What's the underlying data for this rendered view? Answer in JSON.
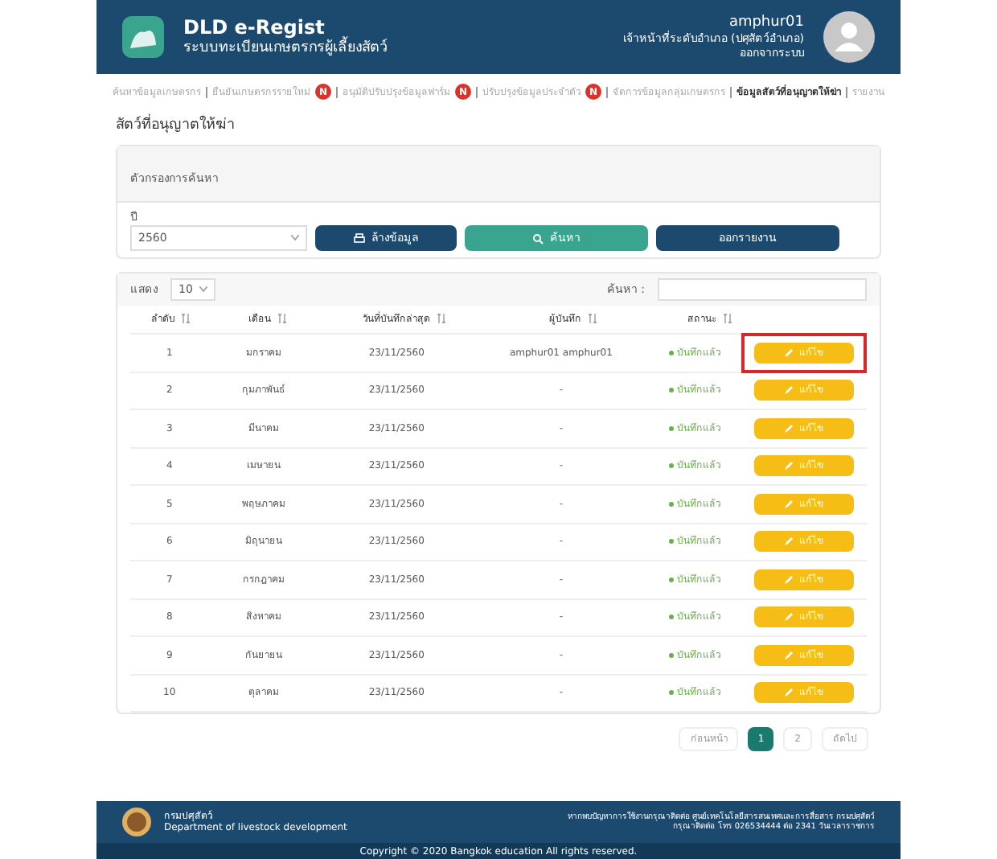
{
  "header": {
    "app_title": "DLD e-Regist",
    "app_subtitle": "ระบบทะเบียนเกษตรกรผู้เลี้ยงสัตว์",
    "username": "amphur01",
    "role": "เจ้าหน้าที่ระดับอำเภอ (ปศุสัตว์อำเภอ)",
    "logout": "ออกจากระบบ"
  },
  "nav": [
    {
      "label": "ค้นหาข้อมูลเกษตรกร",
      "selected": false
    },
    {
      "label": "ยืนยันเกษตรกรรายใหม่",
      "badge": "N",
      "selected": false
    },
    {
      "label": "อนุมัติปรับปรุงข้อมูลฟาร์ม",
      "badge": "N",
      "selected": false
    },
    {
      "label": "ปรับปรุงข้อมูลประจำตัว",
      "badge": "N",
      "selected": false
    },
    {
      "label": "จัดการข้อมูลกลุ่มเกษตรกร",
      "selected": false
    },
    {
      "label": "ข้อมูลสัตว์ที่อนุญาตให้ฆ่า",
      "selected": true
    },
    {
      "label": "รายงาน",
      "selected": false
    }
  ],
  "page_title": "สัตว์ที่อนุญาตให้ฆ่า",
  "filter": {
    "title": "ตัวกรองการค้นหา",
    "year_label": "ปี",
    "year_value": "2560",
    "buttons": [
      {
        "kind": "clear",
        "label": "ล้างข้อมูล"
      },
      {
        "kind": "search",
        "label": "ค้นหา"
      },
      {
        "kind": "report",
        "label": "ออกรายงาน"
      }
    ]
  },
  "table": {
    "show_label": "แสดง",
    "page_size": "10",
    "search_label": "ค้นหา :",
    "columns": [
      "ลำดับ",
      "เดือน",
      "วันที่บันทึกล่าสุด",
      "ผู้บันทึก",
      "สถานะ"
    ],
    "rows": [
      {
        "no": "1",
        "month": "มกราคม",
        "date": "23/11/2560",
        "recorder": "amphur01 amphur01",
        "status": "บันทึกแล้ว",
        "action": "แก้ไข",
        "highlighted": true
      },
      {
        "no": "2",
        "month": "กุมภาพันธ์",
        "date": "23/11/2560",
        "recorder": "-",
        "status": "บันทึกแล้ว",
        "action": "แก้ไข",
        "highlighted": false
      },
      {
        "no": "3",
        "month": "มีนาคม",
        "date": "23/11/2560",
        "recorder": "-",
        "status": "บันทึกแล้ว",
        "action": "แก้ไข",
        "highlighted": false
      },
      {
        "no": "4",
        "month": "เมษายน",
        "date": "23/11/2560",
        "recorder": "-",
        "status": "บันทึกแล้ว",
        "action": "แก้ไข",
        "highlighted": false
      },
      {
        "no": "5",
        "month": "พฤษภาคม",
        "date": "23/11/2560",
        "recorder": "-",
        "status": "บันทึกแล้ว",
        "action": "แก้ไข",
        "highlighted": false
      },
      {
        "no": "6",
        "month": "มิถุนายน",
        "date": "23/11/2560",
        "recorder": "-",
        "status": "บันทึกแล้ว",
        "action": "แก้ไข",
        "highlighted": false
      },
      {
        "no": "7",
        "month": "กรกฎาคม",
        "date": "23/11/2560",
        "recorder": "-",
        "status": "บันทึกแล้ว",
        "action": "แก้ไข",
        "highlighted": false
      },
      {
        "no": "8",
        "month": "สิงหาคม",
        "date": "23/11/2560",
        "recorder": "-",
        "status": "บันทึกแล้ว",
        "action": "แก้ไข",
        "highlighted": false
      },
      {
        "no": "9",
        "month": "กันยายน",
        "date": "23/11/2560",
        "recorder": "-",
        "status": "บันทึกแล้ว",
        "action": "แก้ไข",
        "highlighted": false
      },
      {
        "no": "10",
        "month": "ตุลาคม",
        "date": "23/11/2560",
        "recorder": "-",
        "status": "บันทึกแล้ว",
        "action": "แก้ไข",
        "highlighted": false
      }
    ]
  },
  "pagination": [
    {
      "label": "ก่อนหน้า",
      "selected": false
    },
    {
      "label": "1",
      "selected": true
    },
    {
      "label": "2",
      "selected": false
    },
    {
      "label": "ถัดไป",
      "selected": false
    }
  ],
  "footer": {
    "org_th": "กรมปศุสัตว์",
    "org_en": "Department of livestock development",
    "contact_1": "หากพบปัญหาการใช้งานกรุณาติดต่อ ศูนย์เทคโนโลยีสารสนเทศและการสื่อสาร กรมปศุสัตว์",
    "contact_2": "กรุณาติดต่อ โทร 026534444 ต่อ 2341 วันเวลาราชการ",
    "copyright": "Copyright © 2020 Bangkok education All rights reserved."
  }
}
